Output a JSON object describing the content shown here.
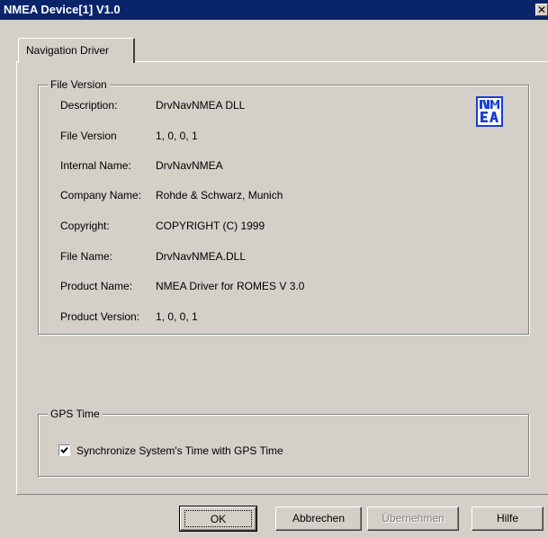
{
  "window": {
    "title": "NMEA Device[1] V1.0",
    "close_glyph": "✕"
  },
  "tabs": [
    {
      "label": "Navigation Driver",
      "selected": true
    }
  ],
  "file_version": {
    "legend": "File Version",
    "logo_text": "NMEA",
    "rows": [
      {
        "label": "Description:",
        "value": "DrvNavNMEA DLL"
      },
      {
        "label": "File Version",
        "value": "1, 0, 0, 1"
      },
      {
        "label": "Internal Name:",
        "value": "DrvNavNMEA"
      },
      {
        "label": "Company Name:",
        "value": "Rohde & Schwarz, Munich"
      },
      {
        "label": "Copyright:",
        "value": "COPYRIGHT (C) 1999"
      },
      {
        "label": "File Name:",
        "value": "DrvNavNMEA.DLL"
      },
      {
        "label": "Product Name:",
        "value": "NMEA Driver for ROMES V 3.0"
      },
      {
        "label": "Product Version:",
        "value": "1, 0, 0, 1"
      }
    ]
  },
  "gps_time": {
    "legend": "GPS Time",
    "sync_checkbox": {
      "label": "Synchronize System's Time with GPS Time",
      "checked": true
    }
  },
  "buttons": {
    "ok": "OK",
    "cancel": "Abbrechen",
    "apply": "Übernehmen",
    "help": "Hilfe"
  },
  "colors": {
    "titlebar": "#0a246a",
    "dialog_face": "#d4d0c8",
    "logo_blue": "#1a3fd6"
  }
}
